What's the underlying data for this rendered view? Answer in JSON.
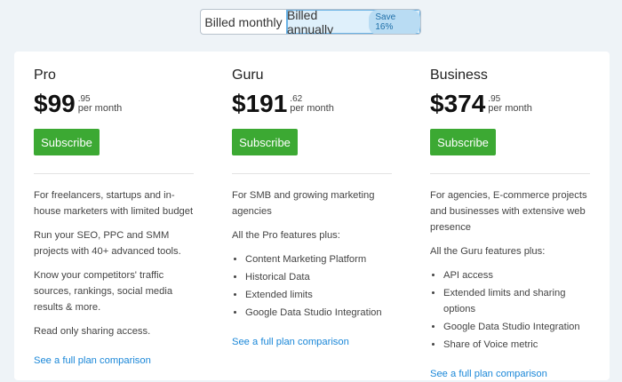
{
  "billing": {
    "monthly_label": "Billed monthly",
    "annual_label": "Billed annually",
    "save_badge": "Save 16%"
  },
  "plans": [
    {
      "name": "Pro",
      "price": "$99",
      "cents": ".95",
      "period": "per month",
      "subscribe_label": "Subscribe",
      "description": [
        "For freelancers, startups and in-house marketers with limited budget",
        "Run your SEO, PPC and SMM projects with 40+ advanced tools.",
        "Know your competitors' traffic sources, rankings, social media results & more.",
        "Read only sharing access."
      ],
      "compare_link": "See a full plan comparison"
    },
    {
      "name": "Guru",
      "price": "$191",
      "cents": ".62",
      "period": "per month",
      "subscribe_label": "Subscribe",
      "description": [
        "For SMB and growing marketing agencies",
        "All the Pro features plus:"
      ],
      "features": [
        "Content Marketing Platform",
        "Historical Data",
        "Extended limits",
        "Google Data Studio Integration"
      ],
      "compare_link": "See a full plan comparison"
    },
    {
      "name": "Business",
      "price": "$374",
      "cents": ".95",
      "period": "per month",
      "subscribe_label": "Subscribe",
      "description": [
        "For agencies, E-commerce projects and businesses with extensive web presence",
        "All the Guru features plus:"
      ],
      "features": [
        "API access",
        "Extended limits and sharing options",
        "Google Data Studio Integration",
        "Share of Voice metric"
      ],
      "compare_link": "See a full plan comparison"
    }
  ]
}
